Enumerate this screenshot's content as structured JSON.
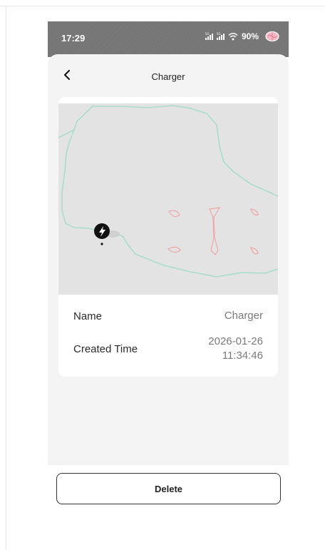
{
  "status_bar": {
    "time": "17:29",
    "battery": "90%",
    "icons": [
      "signal-5g-icon",
      "signal-5g-icon",
      "wifi-icon",
      "brain-icon"
    ]
  },
  "header": {
    "title": "Charger",
    "back_icon": "chevron-left-icon"
  },
  "map": {
    "marker_icon": "charging-station-icon"
  },
  "details": {
    "name_label": "Name",
    "name_value": "Charger",
    "time_label": "Created Time",
    "time_date": "2026-01-26",
    "time_clock": "11:34:46"
  },
  "actions": {
    "delete_label": "Delete"
  },
  "colors": {
    "boundary": "#a9dccc",
    "obstacle": "#f0a6a6",
    "marker": "#111111",
    "accent": "#9c7bd1"
  }
}
